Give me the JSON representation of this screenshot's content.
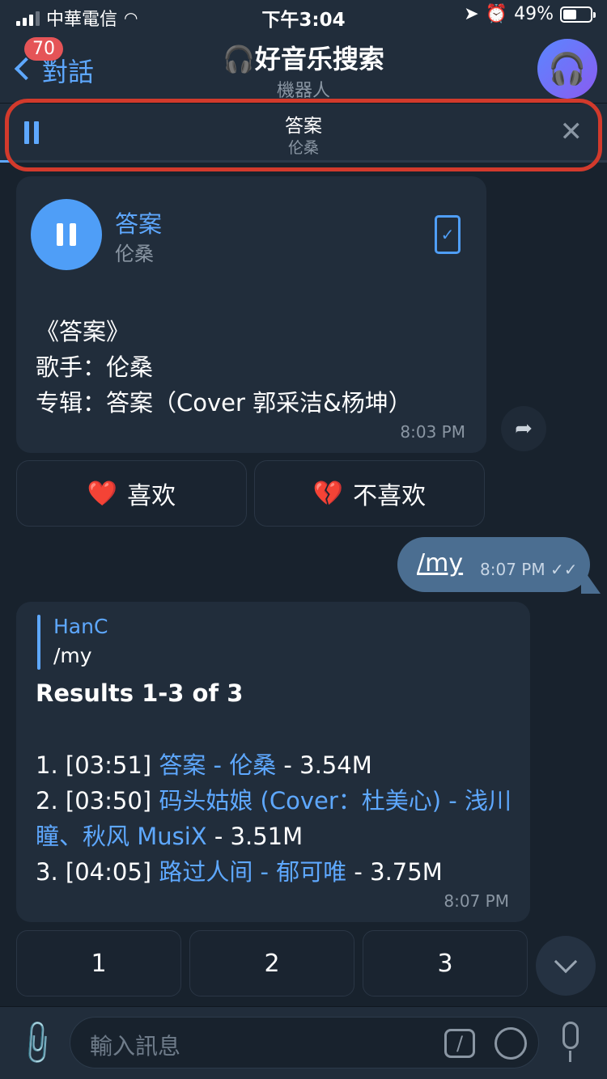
{
  "status_bar": {
    "carrier": "中華電信",
    "time": "下午3:04",
    "battery": "49%",
    "battery_level": 0.49
  },
  "header": {
    "back_label": "對話",
    "unread_badge": "70",
    "title": "🎧好音乐搜索",
    "subtitle": "機器人",
    "avatar_icon": "headphones-icon"
  },
  "player": {
    "title": "答案",
    "artist": "伦桑",
    "progress": 0.02
  },
  "audio_message": {
    "track_name": "答案",
    "track_artist": "伦桑",
    "body": "《答案》\n歌手：伦桑\n专辑：答案（Cover 郭采洁&杨坤）",
    "time": "8:03 PM"
  },
  "rating_buttons": {
    "like": "喜欢",
    "like_emoji": "❤️",
    "dislike": "不喜欢",
    "dislike_emoji": "💔"
  },
  "outgoing_message": {
    "text": "/my",
    "time": "8:07 PM"
  },
  "results_message": {
    "reply_name": "HanC",
    "reply_text": "/my",
    "title": "Results 1-3 of 3",
    "items": [
      {
        "prefix": "1. [03:51] ",
        "link": "答案 - 伦桑",
        "suffix": " - 3.54M"
      },
      {
        "prefix": "2. [03:50] ",
        "link": "码头姑娘 (Cover：杜美心) - 浅川瞳、秋风 MusiX",
        "suffix": " - 3.51M"
      },
      {
        "prefix": "3. [04:05] ",
        "link": "路过人间 - 郁可唯",
        "suffix": " - 3.75M"
      }
    ],
    "time": "8:07 PM"
  },
  "number_buttons": [
    "1",
    "2",
    "3"
  ],
  "input": {
    "placeholder": "輸入訊息"
  },
  "colors": {
    "accent": "#5ea8ff",
    "background": "#18222d",
    "panel": "#212d3b",
    "outgoing": "#4b6e91",
    "highlight": "#d23a2c"
  }
}
